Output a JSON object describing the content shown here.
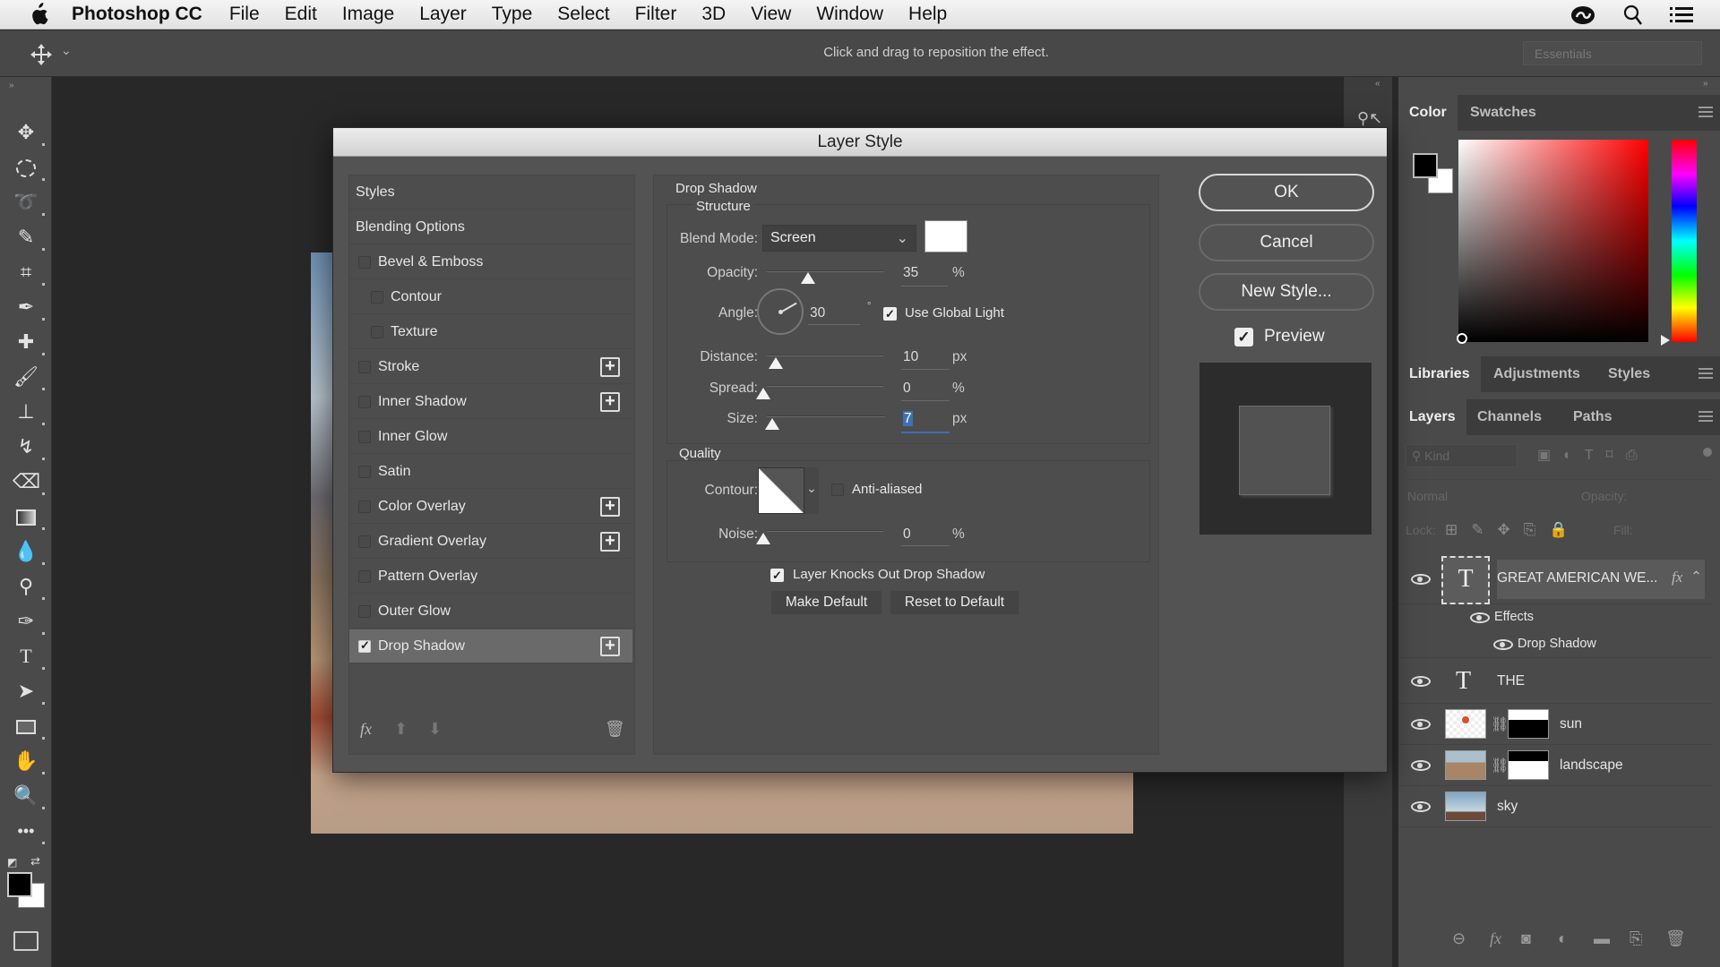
{
  "menubar": {
    "app_name": "Photoshop CC",
    "items": [
      "File",
      "Edit",
      "Image",
      "Layer",
      "Type",
      "Select",
      "Filter",
      "3D",
      "View",
      "Window",
      "Help"
    ],
    "right_icons": [
      "creative-cloud-icon",
      "search-icon",
      "list-icon"
    ]
  },
  "options_bar": {
    "tool_icon": "move-icon",
    "hint": "Click and drag to reposition the effect.",
    "workspace": "Essentials"
  },
  "toolbar": {
    "tools": [
      "move",
      "marquee",
      "lasso",
      "quick-selection",
      "crop",
      "eyedropper",
      "healing-brush",
      "brush",
      "clone-stamp",
      "history-brush",
      "eraser",
      "gradient",
      "blur",
      "dodge",
      "pen",
      "type",
      "path-selection",
      "rectangle",
      "hand",
      "zoom",
      "more"
    ],
    "foreground_color": "#000000",
    "background_color": "#ffffff"
  },
  "dialog": {
    "title": "Layer Style",
    "styles_list": [
      {
        "label": "Styles",
        "checkbox": false,
        "indent": 0,
        "plus": false,
        "checked": false
      },
      {
        "label": "Blending Options",
        "checkbox": false,
        "indent": 0,
        "plus": false,
        "checked": false
      },
      {
        "label": "Bevel & Emboss",
        "checkbox": true,
        "indent": 1,
        "plus": false,
        "checked": false
      },
      {
        "label": "Contour",
        "checkbox": true,
        "indent": 2,
        "plus": false,
        "checked": false
      },
      {
        "label": "Texture",
        "checkbox": true,
        "indent": 2,
        "plus": false,
        "checked": false
      },
      {
        "label": "Stroke",
        "checkbox": true,
        "indent": 1,
        "plus": true,
        "checked": false
      },
      {
        "label": "Inner Shadow",
        "checkbox": true,
        "indent": 1,
        "plus": true,
        "checked": false
      },
      {
        "label": "Inner Glow",
        "checkbox": true,
        "indent": 1,
        "plus": false,
        "checked": false
      },
      {
        "label": "Satin",
        "checkbox": true,
        "indent": 1,
        "plus": false,
        "checked": false
      },
      {
        "label": "Color Overlay",
        "checkbox": true,
        "indent": 1,
        "plus": true,
        "checked": false
      },
      {
        "label": "Gradient Overlay",
        "checkbox": true,
        "indent": 1,
        "plus": true,
        "checked": false
      },
      {
        "label": "Pattern Overlay",
        "checkbox": true,
        "indent": 1,
        "plus": false,
        "checked": false
      },
      {
        "label": "Outer Glow",
        "checkbox": true,
        "indent": 1,
        "plus": false,
        "checked": false
      },
      {
        "label": "Drop Shadow",
        "checkbox": true,
        "indent": 1,
        "plus": true,
        "checked": true,
        "selected": true
      }
    ],
    "footer_icons": [
      "fx-icon",
      "move-up-icon",
      "move-down-icon",
      "trash-icon"
    ],
    "section_title": "Drop Shadow",
    "structure": {
      "title": "Structure",
      "blend_mode_label": "Blend Mode:",
      "blend_mode": "Screen",
      "shadow_color": "#ffffff",
      "opacity_label": "Opacity:",
      "opacity": "35",
      "opacity_unit": "%",
      "angle_label": "Angle:",
      "angle": "30",
      "angle_unit": "°",
      "use_global_light_label": "Use Global Light",
      "use_global_light": true,
      "distance_label": "Distance:",
      "distance": "10",
      "distance_unit": "px",
      "spread_label": "Spread:",
      "spread": "0",
      "spread_unit": "%",
      "size_label": "Size:",
      "size": "7",
      "size_unit": "px"
    },
    "quality": {
      "title": "Quality",
      "contour_label": "Contour:",
      "anti_aliased_label": "Anti-aliased",
      "anti_aliased": false,
      "noise_label": "Noise:",
      "noise": "0",
      "noise_unit": "%"
    },
    "knockout_label": "Layer Knocks Out Drop Shadow",
    "knockout": true,
    "make_default": "Make Default",
    "reset_default": "Reset to Default",
    "ok": "OK",
    "cancel": "Cancel",
    "new_style": "New Style...",
    "preview_label": "Preview",
    "preview": true
  },
  "color_panel": {
    "tabs": [
      "Color",
      "Swatches"
    ],
    "active_tab": "Color",
    "hue_color": "#ff0000"
  },
  "libraries_panel": {
    "tabs": [
      "Libraries",
      "Adjustments",
      "Styles"
    ],
    "active_tab": "Libraries"
  },
  "layers_panel": {
    "tabs": [
      "Layers",
      "Channels",
      "Paths"
    ],
    "active_tab": "Layers",
    "filter_placeholder": "Kind",
    "blend_mode": "Normal",
    "opacity_label": "Opacity:",
    "lock_label": "Lock:",
    "fill_label": "Fill:",
    "layers": [
      {
        "name": "GREAT AMERICAN WE...",
        "type": "text",
        "fx": true,
        "selected": true
      },
      {
        "name": "Effects",
        "type": "effects-group"
      },
      {
        "name": "Drop Shadow",
        "type": "effect"
      },
      {
        "name": "THE",
        "type": "text"
      },
      {
        "name": "sun",
        "type": "image-mask"
      },
      {
        "name": "landscape",
        "type": "image-mask"
      },
      {
        "name": "sky",
        "type": "image"
      }
    ],
    "fx_label": "fx",
    "footer_icons": [
      "link-icon",
      "fx-icon",
      "mask-icon",
      "adjustment-icon",
      "folder-icon",
      "new-layer-icon",
      "trash-icon"
    ]
  }
}
